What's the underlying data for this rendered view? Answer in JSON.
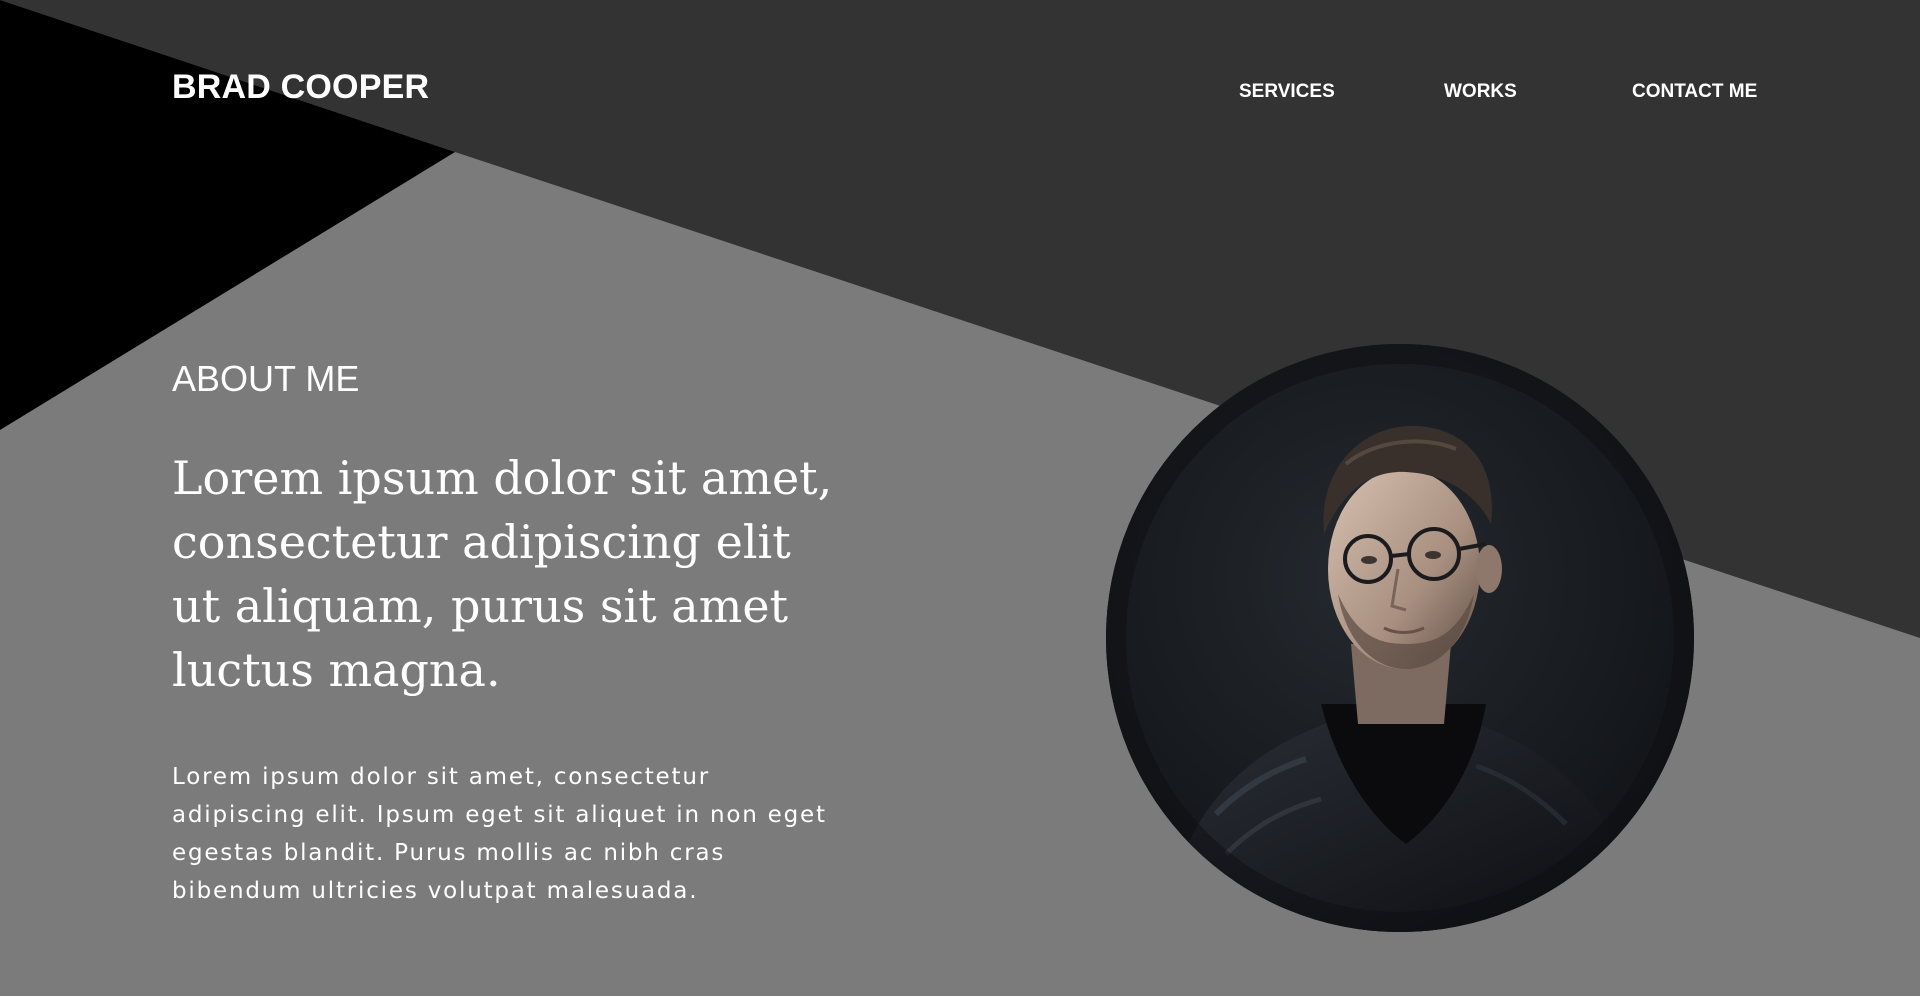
{
  "brand": {
    "name": "BRAD COOPER"
  },
  "nav": {
    "items": [
      {
        "label": "SERVICES"
      },
      {
        "label": "WORKS"
      },
      {
        "label": "CONTACT ME"
      }
    ]
  },
  "about": {
    "heading": "ABOUT ME",
    "lead": "Lorem ipsum dolor sit amet, consectetur adipiscing elit ut aliquam, purus sit amet luctus magna.",
    "body": "Lorem ipsum dolor sit amet, consectetur adipiscing elit. Ipsum eget sit aliquet in non eget egestas blandit. Purus mollis ac nibh cras bibendum ultricies volutpat malesuada."
  },
  "colors": {
    "page_background": "#7b7b7b",
    "dark_band": "#333333",
    "black_corner": "#000000",
    "text": "#ffffff"
  },
  "portrait": {
    "subject": "portrait photo of a young man with glasses in a black leather jacket"
  }
}
